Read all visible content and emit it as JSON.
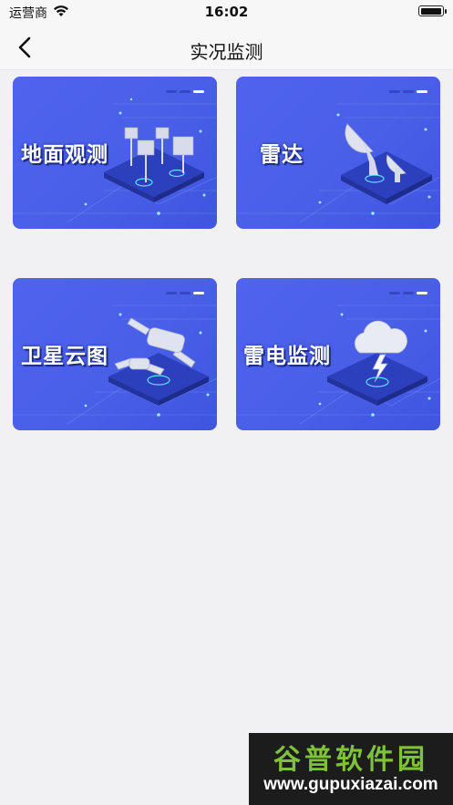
{
  "status_bar": {
    "carrier": "运营商",
    "time": "16:02",
    "battery_level": 1.0
  },
  "nav": {
    "title": "实况监测",
    "back_icon": "chevron-left-icon"
  },
  "cards": [
    {
      "label": "地面观测",
      "icon": "weather-station-icon"
    },
    {
      "label": "雷达",
      "icon": "radar-dish-icon"
    },
    {
      "label": "卫星云图",
      "icon": "satellite-icon"
    },
    {
      "label": "雷电监测",
      "icon": "lightning-cloud-icon"
    }
  ],
  "watermark": {
    "title": "谷普软件园",
    "url": "www.gupuxiazai.com"
  }
}
